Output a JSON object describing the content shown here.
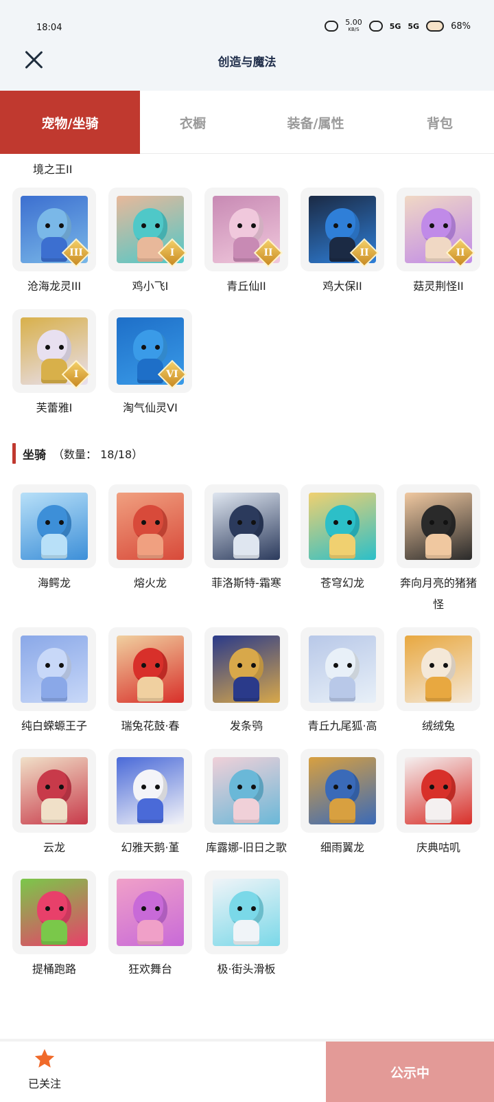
{
  "status_bar": {
    "time": "18:04",
    "net_speed": "5.00",
    "net_unit": "KB/S",
    "sig1": "5G",
    "sig2": "5G",
    "battery": "68%"
  },
  "header": {
    "title": "创造与魔法",
    "close_icon": "close-icon"
  },
  "tabs": [
    {
      "label": "宠物/坐骑",
      "active": true
    },
    {
      "label": "衣橱",
      "active": false
    },
    {
      "label": "装备/属性",
      "active": false
    },
    {
      "label": "背包",
      "active": false
    }
  ],
  "pets_partial_label": "境之王II",
  "pets": [
    {
      "name": "沧海龙灵III",
      "badge": "III",
      "colors": [
        "#7ab8e8",
        "#3c6fd0"
      ]
    },
    {
      "name": "鸡小飞I",
      "badge": "I",
      "colors": [
        "#4fc8c8",
        "#e8b89a"
      ]
    },
    {
      "name": "青丘仙II",
      "badge": "II",
      "colors": [
        "#f0c8dc",
        "#c88ab4"
      ]
    },
    {
      "name": "鸡大保II",
      "badge": "II",
      "colors": [
        "#2f7fd8",
        "#1b2a44"
      ]
    },
    {
      "name": "菇灵荆怪II",
      "badge": "II",
      "colors": [
        "#c08ae8",
        "#f0d8c4"
      ]
    },
    {
      "name": "芙蕾雅I",
      "badge": "I",
      "colors": [
        "#e8e0f0",
        "#d8b04a"
      ]
    },
    {
      "name": "淘气仙灵VI",
      "badge": "VI",
      "colors": [
        "#3a9be8",
        "#1e6fc8"
      ]
    }
  ],
  "mounts_section": {
    "title": "坐骑",
    "count_label": "（数量：  18/18）"
  },
  "mounts": [
    {
      "name": "海鳄龙",
      "colors": [
        "#3d8fd8",
        "#b8e0f8"
      ]
    },
    {
      "name": "熔火龙",
      "colors": [
        "#d84a3a",
        "#f0a080"
      ]
    },
    {
      "name": "菲洛斯特-霜寒",
      "colors": [
        "#2b3a5c",
        "#dfe6f0"
      ]
    },
    {
      "name": "苍穹幻龙",
      "colors": [
        "#2cbfc8",
        "#f0d070"
      ]
    },
    {
      "name": "奔向月亮的猪猪怪",
      "colors": [
        "#2a2a2a",
        "#f0c8a0"
      ]
    },
    {
      "name": "纯白蝾螈王子",
      "colors": [
        "#c8d8f8",
        "#8aa8e8"
      ]
    },
    {
      "name": "瑞兔花鼓·春",
      "colors": [
        "#d8302a",
        "#f0d0a0"
      ]
    },
    {
      "name": "发条鸮",
      "colors": [
        "#d8a84a",
        "#2a3a8a"
      ]
    },
    {
      "name": "青丘九尾狐·高",
      "colors": [
        "#e8f0f8",
        "#b8c8e8"
      ]
    },
    {
      "name": "绒绒兔",
      "colors": [
        "#f4e8d8",
        "#e8a840"
      ]
    },
    {
      "name": "云龙",
      "colors": [
        "#c83a4a",
        "#f0e0c8"
      ]
    },
    {
      "name": "幻雅天鹅·堇",
      "colors": [
        "#f4f4f8",
        "#4a6ad8"
      ]
    },
    {
      "name": "库露娜-旧日之歌",
      "colors": [
        "#6ab8d8",
        "#f0d0d8"
      ]
    },
    {
      "name": "细雨翼龙",
      "colors": [
        "#3a6ab8",
        "#d8a040"
      ]
    },
    {
      "name": "庆典咕叽",
      "colors": [
        "#d8302a",
        "#f4f0f0"
      ]
    },
    {
      "name": "提桶跑路",
      "colors": [
        "#e8406a",
        "#7ac84a"
      ]
    },
    {
      "name": "狂欢舞台",
      "colors": [
        "#c86ad8",
        "#f0a0c8"
      ]
    },
    {
      "name": "极·街头滑板",
      "colors": [
        "#7ad8e8",
        "#f0f4f8"
      ]
    }
  ],
  "bottom": {
    "follow_label": "已关注",
    "follow_icon": "star-icon",
    "star_color": "#f06a2a",
    "publish_label": "公示中"
  },
  "colors": {
    "accent": "#c0392f",
    "publish": "#e39a97"
  }
}
